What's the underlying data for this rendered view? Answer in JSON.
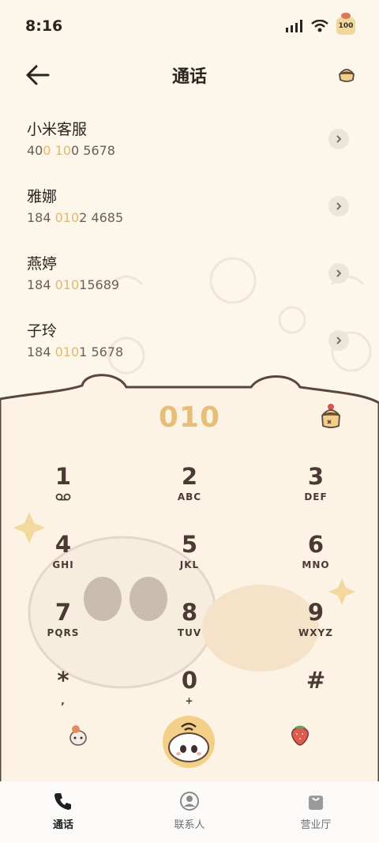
{
  "status_bar": {
    "time": "8:16",
    "battery": "100"
  },
  "header": {
    "title": "通话"
  },
  "recent_calls": [
    {
      "name": "小米客服",
      "number_parts": [
        "40",
        "0",
        " ",
        "10",
        "0 5678"
      ]
    },
    {
      "name": "雅娜",
      "number_parts": [
        "184 ",
        "010",
        "2 4685"
      ]
    },
    {
      "name": "燕婷",
      "number_parts": [
        "184 ",
        "010",
        "15689"
      ]
    },
    {
      "name": "子玲",
      "number_parts": [
        "184 ",
        "010",
        "1 5678"
      ]
    }
  ],
  "dialpad": {
    "input": "010",
    "keys": [
      {
        "digit": "1",
        "letters": ""
      },
      {
        "digit": "2",
        "letters": "ABC"
      },
      {
        "digit": "3",
        "letters": "DEF"
      },
      {
        "digit": "4",
        "letters": "GHI"
      },
      {
        "digit": "5",
        "letters": "JKL"
      },
      {
        "digit": "6",
        "letters": "MNO"
      },
      {
        "digit": "7",
        "letters": "PQRS"
      },
      {
        "digit": "8",
        "letters": "TUV"
      },
      {
        "digit": "9",
        "letters": "WXYZ"
      },
      {
        "digit": "*",
        "letters": ","
      },
      {
        "digit": "0",
        "letters": "+"
      },
      {
        "digit": "#",
        "letters": ""
      }
    ]
  },
  "bottom_nav": [
    {
      "label": "通话",
      "icon": "phone-icon",
      "active": true
    },
    {
      "label": "联系人",
      "icon": "contact-icon",
      "active": false
    },
    {
      "label": "营业厅",
      "icon": "shopping-bag-icon",
      "active": false
    }
  ],
  "colors": {
    "accent": "#e6be78",
    "background": "#fdf6ea",
    "text": "#2b2420",
    "call_button": "#f3cf88"
  }
}
